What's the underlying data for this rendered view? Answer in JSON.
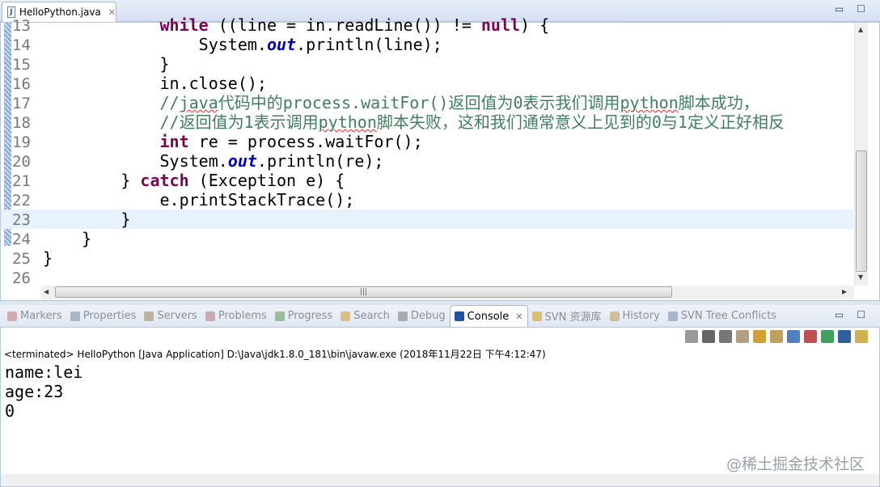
{
  "editor_tab": {
    "title": "HelloPython.java",
    "icon": "java-file-icon"
  },
  "code_lines": [
    {
      "n": "13",
      "tokens": [
        {
          "t": "            ",
          "c": "pl"
        },
        {
          "t": "while",
          "c": "kw"
        },
        {
          "t": " ((line = in.readLine()) != ",
          "c": "pl"
        },
        {
          "t": "null",
          "c": "kw"
        },
        {
          "t": ") {",
          "c": "pl"
        }
      ]
    },
    {
      "n": "14",
      "tokens": [
        {
          "t": "                System.",
          "c": "pl"
        },
        {
          "t": "out",
          "c": "fd"
        },
        {
          "t": ".println(line);",
          "c": "pl"
        }
      ]
    },
    {
      "n": "15",
      "tokens": [
        {
          "t": "            }",
          "c": "pl"
        }
      ]
    },
    {
      "n": "16",
      "tokens": [
        {
          "t": "            in.close();",
          "c": "pl"
        }
      ]
    },
    {
      "n": "17",
      "tokens": [
        {
          "t": "            ",
          "c": "pl"
        },
        {
          "t": "//",
          "c": "cm"
        },
        {
          "t": "java",
          "c": "cm squig"
        },
        {
          "t": "代码中的process.waitFor()返回值为0表示我们调用",
          "c": "cm"
        },
        {
          "t": "python",
          "c": "cm squig"
        },
        {
          "t": "脚本成功，",
          "c": "cm"
        }
      ]
    },
    {
      "n": "18",
      "tokens": [
        {
          "t": "            ",
          "c": "pl"
        },
        {
          "t": "//返回值为1表示调用",
          "c": "cm"
        },
        {
          "t": "python",
          "c": "cm squig"
        },
        {
          "t": "脚本失败，这和我们通常意义上见到的0与1定义正好相反",
          "c": "cm"
        }
      ]
    },
    {
      "n": "19",
      "tokens": [
        {
          "t": "            ",
          "c": "pl"
        },
        {
          "t": "int",
          "c": "kw"
        },
        {
          "t": " re = process.waitFor();",
          "c": "pl"
        }
      ]
    },
    {
      "n": "20",
      "tokens": [
        {
          "t": "            System.",
          "c": "pl"
        },
        {
          "t": "out",
          "c": "fd"
        },
        {
          "t": ".println(re);",
          "c": "pl"
        }
      ]
    },
    {
      "n": "21",
      "tokens": [
        {
          "t": "        } ",
          "c": "pl"
        },
        {
          "t": "catch",
          "c": "kw"
        },
        {
          "t": " (Exception e) {",
          "c": "pl"
        }
      ]
    },
    {
      "n": "22",
      "tokens": [
        {
          "t": "            e.printStackTrace();",
          "c": "pl"
        }
      ]
    },
    {
      "n": "23",
      "current": true,
      "tokens": [
        {
          "t": "        }",
          "c": "pl"
        }
      ]
    },
    {
      "n": "24",
      "tokens": [
        {
          "t": "    }",
          "c": "pl"
        }
      ]
    },
    {
      "n": "25",
      "tokens": [
        {
          "t": "}",
          "c": "pl"
        }
      ]
    },
    {
      "n": "26",
      "tokens": []
    }
  ],
  "view_tabs": [
    {
      "label": "Markers",
      "icon": "markers-icon",
      "color": "#c08080"
    },
    {
      "label": "Properties",
      "icon": "properties-icon",
      "color": "#8090a0"
    },
    {
      "label": "Servers",
      "icon": "servers-icon",
      "color": "#a09060"
    },
    {
      "label": "Problems",
      "icon": "problems-icon",
      "color": "#b08080"
    },
    {
      "label": "Progress",
      "icon": "progress-icon",
      "color": "#60a060"
    },
    {
      "label": "Search",
      "icon": "search-icon",
      "color": "#d0a040"
    },
    {
      "label": "Debug",
      "icon": "debug-icon",
      "color": "#808080"
    },
    {
      "label": "Console",
      "icon": "console-icon",
      "color": "#2050a0",
      "active": true
    },
    {
      "label": "SVN 资源库",
      "icon": "svn-repository-icon",
      "color": "#d0a020"
    },
    {
      "label": "History",
      "icon": "history-icon",
      "color": "#c0a060"
    },
    {
      "label": "SVN Tree Conflicts",
      "icon": "svn-tree-conflicts-icon",
      "color": "#8090b0"
    }
  ],
  "console_toolbar": [
    {
      "name": "terminate-icon",
      "color": "#999"
    },
    {
      "name": "remove-launch-icon",
      "color": "#666"
    },
    {
      "name": "remove-all-icon",
      "color": "#777"
    },
    {
      "name": "clear-console-icon",
      "color": "#b0a080"
    },
    {
      "name": "scroll-lock-icon",
      "color": "#d0a030"
    },
    {
      "name": "word-wrap-icon",
      "color": "#c0a060"
    },
    {
      "name": "show-on-stdout-icon",
      "color": "#5080c0"
    },
    {
      "name": "show-on-stderr-icon",
      "color": "#c05050"
    },
    {
      "name": "pin-console-icon",
      "color": "#40a060"
    },
    {
      "name": "display-console-icon",
      "color": "#3060a0"
    },
    {
      "name": "open-console-icon",
      "color": "#d0b050"
    }
  ],
  "console": {
    "status": "<terminated> HelloPython [Java Application] D:\\Java\\jdk1.8.0_181\\bin\\javaw.exe (2018年11月22日 下午4:12:47)",
    "output": "name:lei\nage:23\n0"
  },
  "watermark": "@稀土掘金技术社区"
}
